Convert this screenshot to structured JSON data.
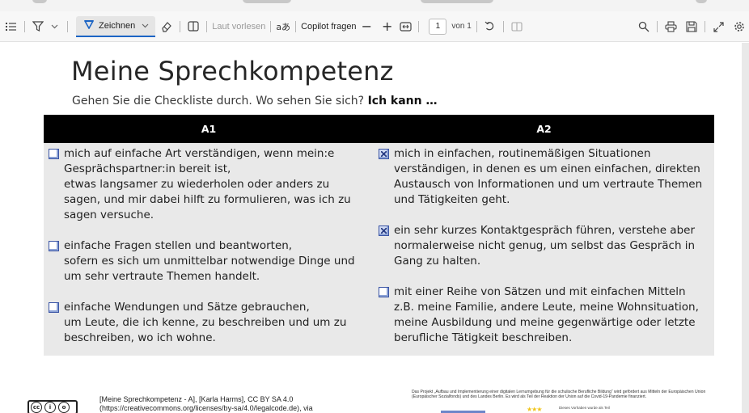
{
  "toolbar": {
    "draw_label": "Zeichnen",
    "read_aloud_label": "Laut vorlesen",
    "text_option_label": "aあ",
    "copilot_label": "Copilot fragen",
    "zoom_out_symbol": "−",
    "zoom_in_symbol": "+",
    "page_current": "1",
    "page_total": "von 1"
  },
  "document": {
    "title": "Meine Sprechkompetenz",
    "subtitle_prefix": "Gehen Sie die Checkliste durch. Wo sehen Sie sich?",
    "subtitle_bold": "Ich kann …",
    "columns": [
      "A1",
      "A2"
    ],
    "a1_items": [
      {
        "checked": false,
        "text": "mich auf einfache Art verständigen, wenn mein:e\nGesprächspartner:in bereit ist,\netwas langsamer zu wiederholen oder anders zu\nsagen, und mir dabei hilft zu formulieren, was ich zu\nsagen versuche."
      },
      {
        "checked": false,
        "text": "einfache Fragen stellen und beantworten,\nsofern es sich um unmittelbar notwendige Dinge und\num sehr vertraute Themen handelt."
      },
      {
        "checked": false,
        "text": "einfache Wendungen und Sätze gebrauchen,\num Leute, die ich kenne, zu beschreiben und um zu\nbeschreiben, wo ich wohne."
      }
    ],
    "a2_items": [
      {
        "checked": true,
        "text": "mich in einfachen, routinemäßigen Situationen\nverständigen, in denen es um einen einfachen, direkten\nAustausch von Informationen und um vertraute Themen\nund Tätigkeiten geht."
      },
      {
        "checked": true,
        "text": "ein sehr kurzes Kontaktgespräch führen, verstehe aber\nnormalerweise nicht genug, um selbst das Gespräch in\nGang zu halten."
      },
      {
        "checked": false,
        "text": "mit einer Reihe von Sätzen und mit einfachen Mitteln\nz.B. meine Familie, andere Leute, meine Wohnsituation,\nmeine Ausbildung und meine gegenwärtige oder letzte\nberufliche Tätigkeit beschreiben."
      }
    ]
  },
  "footer": {
    "attribution": "[Meine Sprechkompetenz - A], [Karla Harms], CC BY SA 4.0\n(https://creativecommons.org/licenses/by-sa/4.0/legalcode.de), via",
    "project_text": "Das Projekt „Aufbau und Implementierung einer digitalen Lernumgebung für die schulische Berufliche Bildung“ wird gefördert aus Mitteln der Europäischen Union (Europäischer Sozialfonds) und des Landes Berlin. Es wird als Teil der Reaktion der Union auf die Covid-19-Pandemie finanziert.",
    "small_note": "Dieses Vorhaben wurde als Teil",
    "cc_symbols": [
      "cc",
      "i",
      "o"
    ]
  },
  "colors": {
    "accent": "#1b64c4",
    "header_bg": "#000000",
    "cell_bg": "#e9e9e9"
  }
}
